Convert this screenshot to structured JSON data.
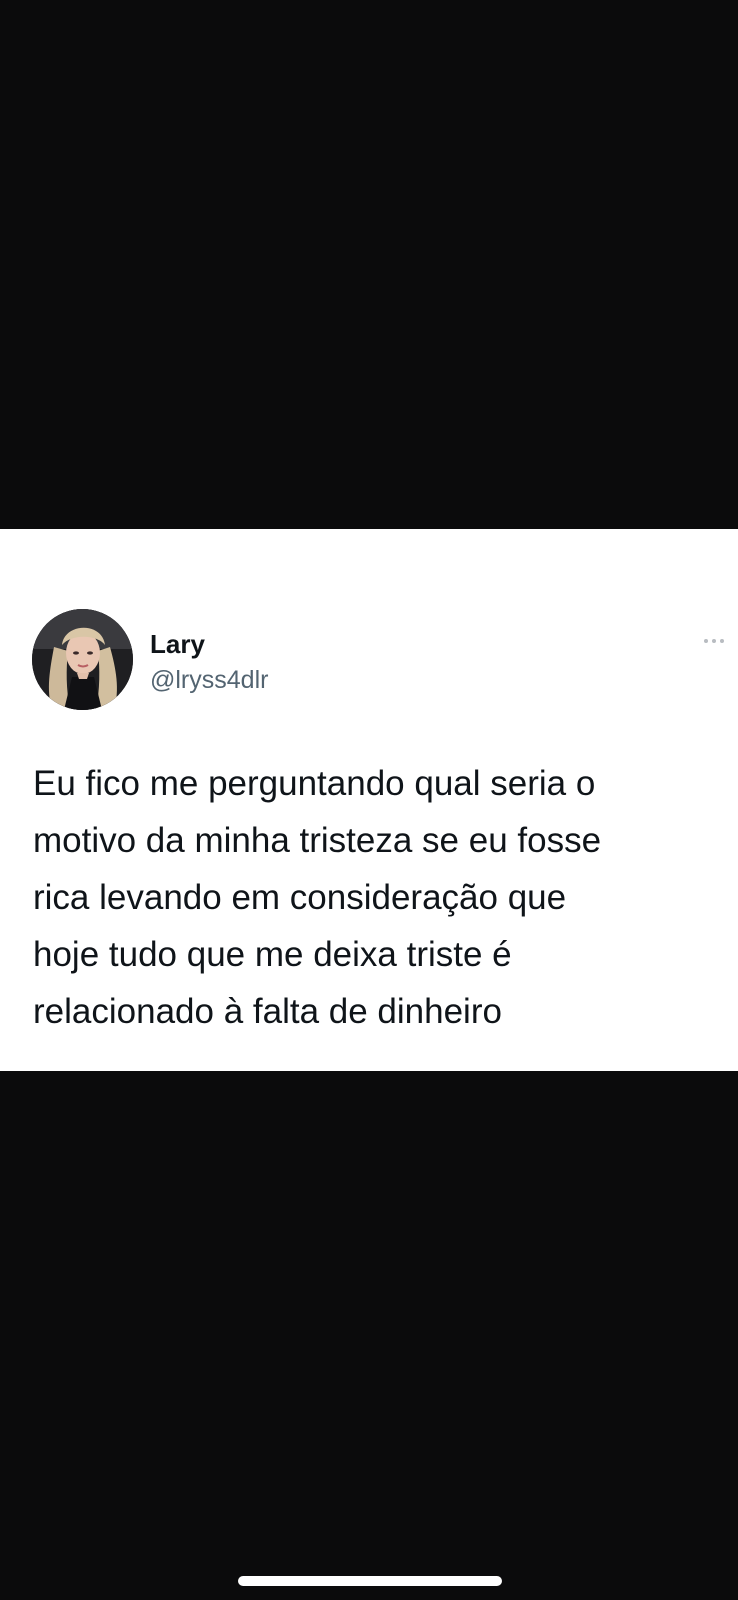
{
  "tweet": {
    "author": {
      "name": "Lary",
      "handle": "@lryss4dlr",
      "avatar_icon": "profile-photo"
    },
    "more_icon": "more-horizontal-icon",
    "text_lines": [
      "Eu fico me perguntando qual seria o",
      "motivo da minha tristeza se eu fosse",
      "rica levando em consideração que",
      "hoje tudo que me deixa triste é",
      "relacionado à falta de dinheiro"
    ]
  },
  "colors": {
    "background": "#0b0b0c",
    "card": "#ffffff",
    "text_primary": "#0f1419",
    "text_secondary": "#536471"
  }
}
